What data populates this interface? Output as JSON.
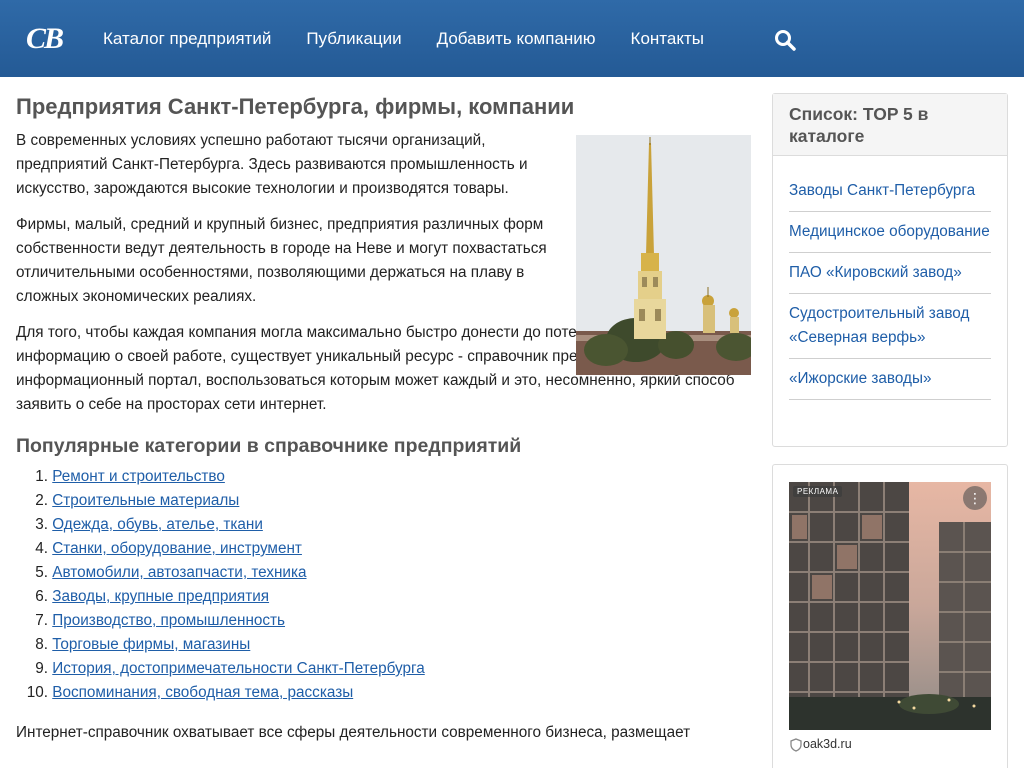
{
  "header": {
    "logo": "CB",
    "nav": [
      "Каталог предприятий",
      "Публикации",
      "Добавить компанию",
      "Контакты"
    ],
    "search_icon": "search-icon"
  },
  "main": {
    "title": "Предприятия Санкт-Петербурга, фирмы, компании",
    "paragraphs": [
      "В современных условиях успешно работают тысячи организаций, предприятий Санкт-Петербурга. Здесь развиваются промышленность и искусство, зарождаются высокие технологии и производятся товары.",
      "Фирмы, малый, средний и крупный бизнес, предприятия различных форм собственности ведут деятельность в городе на Неве и могут похвастаться отличительными особенностями, позволяющими держаться на плаву в сложных экономических реалиях.",
      "Для того, чтобы каждая компания могла максимально быстро донести до потенциального клиента информацию о своей работе, существует уникальный ресурс - справочник предприятий. Справочно-информационный портал, воспользоваться которым может каждый и это, несомненно, яркий способ заявить о себе на просторах сети интернет."
    ],
    "categories_title": "Популярные категории в справочнике предприятий",
    "categories": [
      {
        "num": "1.",
        "label": "Ремонт и строительство"
      },
      {
        "num": "2.",
        "label": "Строительные материалы"
      },
      {
        "num": "3.",
        "label": "Одежда, обувь, ателье, ткани"
      },
      {
        "num": "4.",
        "label": "Станки, оборудование, инструмент"
      },
      {
        "num": "5.",
        "label": "Автомобили, автозапчасти, техника"
      },
      {
        "num": "6.",
        "label": "Заводы, крупные предприятия"
      },
      {
        "num": "7.",
        "label": "Производство, промышленность"
      },
      {
        "num": "8.",
        "label": "Торговые фирмы, магазины"
      },
      {
        "num": "9.",
        "label": "История, достопримечательности Санкт-Петербурга"
      },
      {
        "num": "10.",
        "label": "Воспоминания, свободная тема, рассказы"
      }
    ],
    "bottom_text": "Интернет-справочник охватывает все сферы деятельности современного бизнеса, размещает"
  },
  "sidebar": {
    "title": "Список: TOP 5 в каталоге",
    "items": [
      "Заводы Санкт-Петербурга",
      "Медицинское оборудование",
      "ПАО «Кировский завод»",
      "Судостроительный завод «Северная верфь»",
      "«Ижорские заводы»"
    ]
  },
  "ad": {
    "badge": "РЕКЛАМА",
    "source": "oak3d.ru"
  },
  "colors": {
    "header_bg": "#2a63a0",
    "link": "#1f5ea8",
    "heading": "#555555"
  }
}
